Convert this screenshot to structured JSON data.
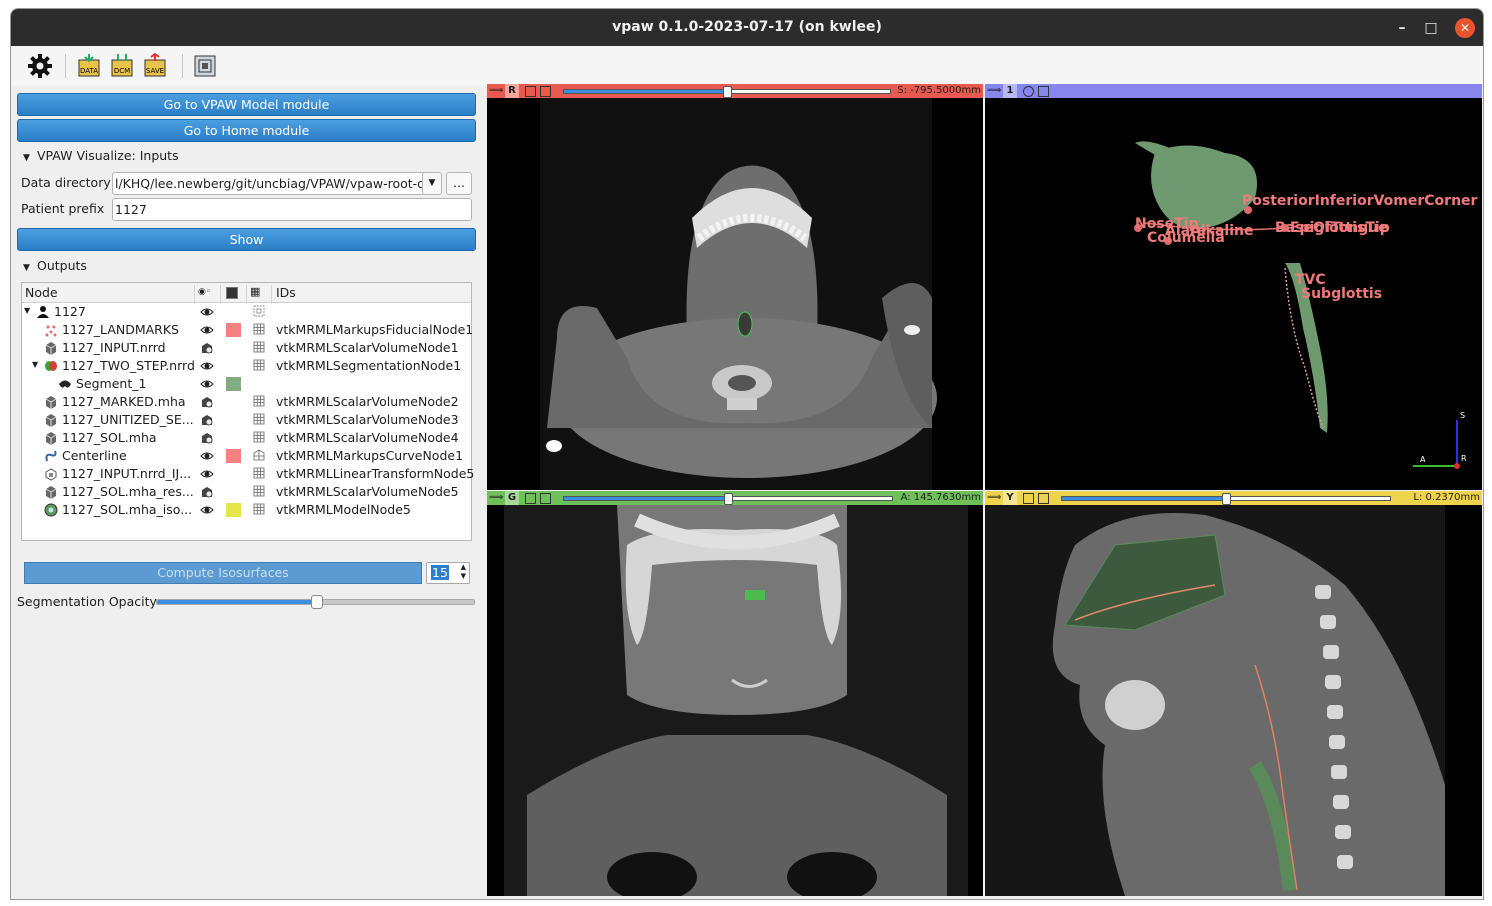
{
  "window": {
    "title": "vpaw 0.1.0-2023-07-17 (on kwlee)"
  },
  "toolbar": {
    "icons": [
      "gear-icon",
      "data-icon",
      "dcm-icon",
      "save-icon",
      "layout-icon"
    ],
    "data_label": "DATA",
    "dcm_label": "DCM",
    "save_label": "SAVE"
  },
  "buttons": {
    "model": "Go to VPAW Model module",
    "home": "Go to Home module",
    "show": "Show",
    "compute": "Compute Isosurfaces",
    "browse": "..."
  },
  "inputs_section": {
    "title": "VPAW Visualize: Inputs",
    "data_dir_label": "Data directory",
    "data_dir_value": "l/KHQ/lee.newberg/git/uncbiag/VPAW/vpaw-root-dir",
    "prefix_label": "Patient prefix",
    "prefix_value": "1127"
  },
  "outputs_section": {
    "title": "Outputs",
    "columns": {
      "node": "Node",
      "ids": "IDs"
    },
    "rows": [
      {
        "name": "1127",
        "id": "",
        "color": ""
      },
      {
        "name": "1127_LANDMARKS",
        "id": "vtkMRMLMarkupsFiducialNode1",
        "color": "#f58080"
      },
      {
        "name": "1127_INPUT.nrrd",
        "id": "vtkMRMLScalarVolumeNode1",
        "color": ""
      },
      {
        "name": "1127_TWO_STEP.nrrd",
        "id": "vtkMRMLSegmentationNode1",
        "color": ""
      },
      {
        "name": "Segment_1",
        "id": "",
        "color": "#80ae80"
      },
      {
        "name": "1127_MARKED.mha",
        "id": "vtkMRMLScalarVolumeNode2",
        "color": ""
      },
      {
        "name": "1127_UNITIZED_SE...",
        "id": "vtkMRMLScalarVolumeNode3",
        "color": ""
      },
      {
        "name": "1127_SOL.mha",
        "id": "vtkMRMLScalarVolumeNode4",
        "color": ""
      },
      {
        "name": "Centerline",
        "id": "vtkMRMLMarkupsCurveNode1",
        "color": "#f58080"
      },
      {
        "name": "1127_INPUT.nrrd_IJ...",
        "id": "vtkMRMLLinearTransformNode5",
        "color": ""
      },
      {
        "name": "1127_SOL.mha_res...",
        "id": "vtkMRMLScalarVolumeNode5",
        "color": ""
      },
      {
        "name": "1127_SOL.mha_iso...",
        "id": "vtkMRMLModelNode5",
        "color": "#e6e64c"
      }
    ]
  },
  "isosurface": {
    "spin_value": "15"
  },
  "opacity": {
    "label": "Segmentation Opacity",
    "value": 0.5
  },
  "views": {
    "red": {
      "label": "R",
      "value": "S: -795.5000mm",
      "slider": 0.5,
      "color": "#e85a4f"
    },
    "threed": {
      "label": "1",
      "color": "#8686ee"
    },
    "green": {
      "label": "G",
      "value": "A: 145.7630mm",
      "slider": 0.5,
      "color": "#6fbf5a"
    },
    "yellow": {
      "label": "Y",
      "value": "L: 0.2370mm",
      "slider": 0.5,
      "color": "#eed34c"
    }
  },
  "landmarks3d": [
    "PosteriorInferiorVomerCorner",
    "NoseTip",
    "Columella",
    "Alare",
    "Alkaline",
    "BaseOfTongue",
    "EpiglottisTip",
    "TVC",
    "Subglottis"
  ],
  "axes3d": {
    "s": "S",
    "a": "A",
    "r": "R"
  }
}
